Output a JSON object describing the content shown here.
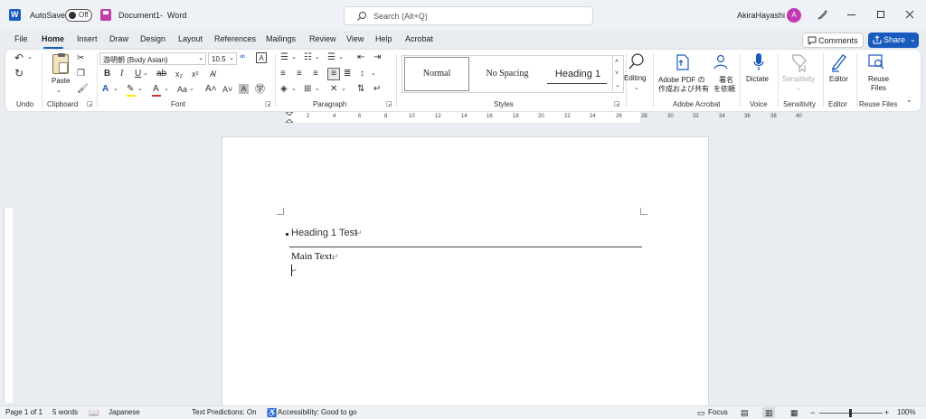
{
  "titlebar": {
    "autosave_label": "AutoSave",
    "autosave_state": "Off",
    "doc_title": "Document1",
    "separator": "-",
    "app_name": "Word",
    "search_placeholder": "Search (Alt+Q)",
    "user_name": "AkiraHayashi",
    "avatar_initial": "A"
  },
  "tabs": [
    "File",
    "Home",
    "Insert",
    "Draw",
    "Design",
    "Layout",
    "References",
    "Mailings",
    "Review",
    "View",
    "Help",
    "Acrobat"
  ],
  "active_tab": "Home",
  "actions": {
    "comments": "Comments",
    "share": "Share"
  },
  "ribbon": {
    "undo_group": "Undo",
    "clipboard": {
      "paste": "Paste",
      "group": "Clipboard"
    },
    "font": {
      "name": "游明朝 (Body Asian)",
      "size": "10.5",
      "group": "Font"
    },
    "paragraph": {
      "group": "Paragraph"
    },
    "styles": {
      "normal": "Normal",
      "no_spacing": "No Spacing",
      "heading1": "Heading 1",
      "group": "Styles"
    },
    "editing": {
      "label": "Editing"
    },
    "adobe": {
      "create_line1": "Adobe PDF の",
      "create_line2": "作成および共有",
      "sign_line1": "署名",
      "sign_line2": "を依頼",
      "group": "Adobe Acrobat"
    },
    "voice": {
      "dictate": "Dictate",
      "group": "Voice"
    },
    "sensitivity": {
      "label": "Sensitivity",
      "group": "Sensitivity"
    },
    "editor": {
      "label": "Editor",
      "group": "Editor"
    },
    "reuse": {
      "line1": "Reuse",
      "line2": "Files",
      "group": "Reuse Files"
    }
  },
  "ruler": {
    "numbers": [
      "2",
      "4",
      "6",
      "8",
      "10",
      "12",
      "14",
      "16",
      "18",
      "20",
      "22",
      "24",
      "26",
      "28",
      "30",
      "32",
      "34",
      "36",
      "38",
      "40"
    ]
  },
  "document": {
    "heading": "Heading 1 Test",
    "body": "Main Text."
  },
  "statusbar": {
    "page": "Page 1 of 1",
    "words": "5 words",
    "language": "Japanese",
    "predictions": "Text Predictions: On",
    "accessibility": "Accessibility: Good to go",
    "focus": "Focus",
    "zoom": "100%"
  },
  "colors": {
    "accent": "#185abd",
    "avatar": "#c239b3"
  }
}
